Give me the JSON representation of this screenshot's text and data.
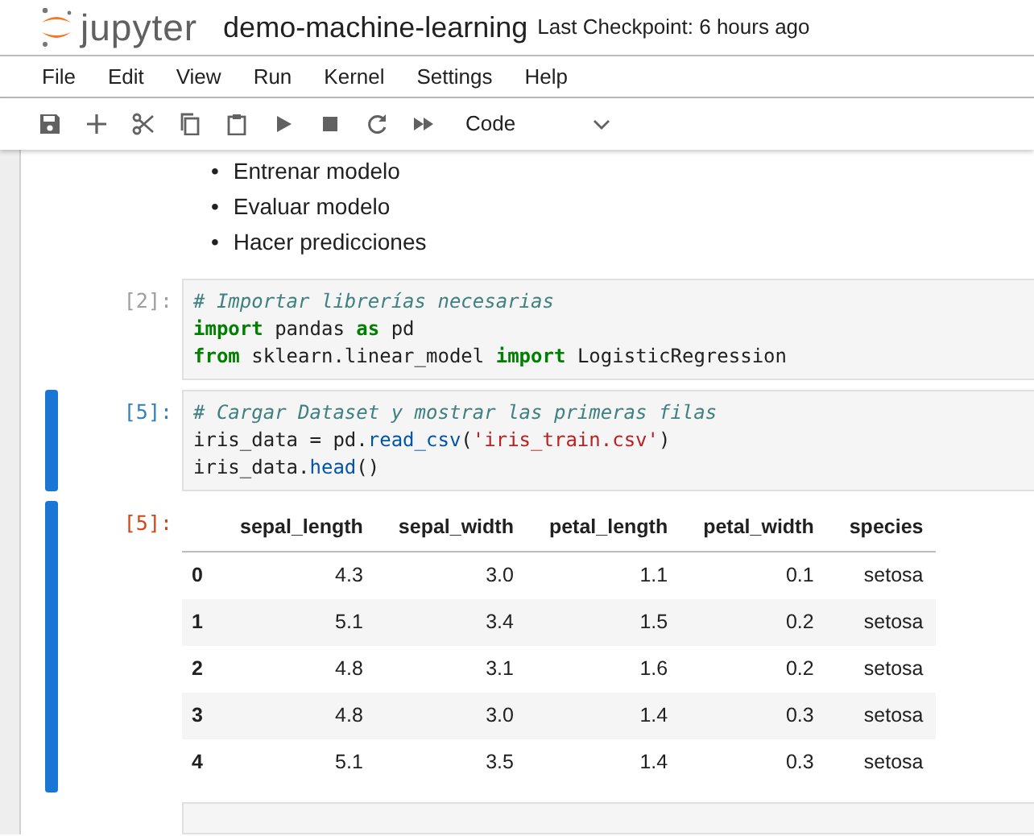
{
  "header": {
    "logo_text": "jupyter",
    "notebook_title": "demo-machine-learning",
    "checkpoint": "Last Checkpoint: 6 hours ago"
  },
  "menu": [
    "File",
    "Edit",
    "View",
    "Run",
    "Kernel",
    "Settings",
    "Help"
  ],
  "toolbar": {
    "buttons": [
      {
        "kind": "save"
      },
      {
        "kind": "add"
      },
      {
        "kind": "cut"
      },
      {
        "kind": "copy"
      },
      {
        "kind": "paste"
      },
      {
        "kind": "run"
      },
      {
        "kind": "stop"
      },
      {
        "kind": "restart"
      },
      {
        "kind": "run-all"
      }
    ],
    "cell_type": "Code"
  },
  "cells": [
    {
      "kind": "markdown",
      "active": false,
      "bullets": [
        {
          "marker": "•",
          "text": "Entrenar modelo"
        },
        {
          "marker": "•",
          "text": "Evaluar modelo"
        },
        {
          "marker": "•",
          "text": "Hacer predicciones"
        }
      ]
    },
    {
      "kind": "code",
      "active": false,
      "prompt": "[2]:",
      "lines": [
        [
          {
            "kind": "comment",
            "text": "# Importar librerías necesarias"
          }
        ],
        [
          {
            "kind": "keyword",
            "text": "import"
          },
          {
            "kind": "plain",
            "text": " pandas "
          },
          {
            "kind": "keyword",
            "text": "as"
          },
          {
            "kind": "plain",
            "text": " pd"
          }
        ],
        [
          {
            "kind": "keyword",
            "text": "from"
          },
          {
            "kind": "plain",
            "text": " sklearn.linear_model "
          },
          {
            "kind": "keyword",
            "text": "import"
          },
          {
            "kind": "plain",
            "text": " LogisticRegression"
          }
        ]
      ]
    },
    {
      "kind": "code",
      "active": true,
      "prompt": "[5]:",
      "lines": [
        [
          {
            "kind": "comment",
            "text": "# Cargar Dataset y mostrar las primeras filas"
          }
        ],
        [
          {
            "kind": "plain",
            "text": "iris_data = pd."
          },
          {
            "kind": "func",
            "text": "read_csv"
          },
          {
            "kind": "plain",
            "text": "("
          },
          {
            "kind": "string",
            "text": "'iris_train.csv'"
          },
          {
            "kind": "plain",
            "text": ")"
          }
        ],
        [
          {
            "kind": "plain",
            "text": "iris_data."
          },
          {
            "kind": "func",
            "text": "head"
          },
          {
            "kind": "plain",
            "text": "()"
          }
        ]
      ]
    },
    {
      "kind": "output",
      "active": true,
      "prompt": "[5]:",
      "table": {
        "columns": [
          "sepal_length",
          "sepal_width",
          "petal_length",
          "petal_width",
          "species"
        ],
        "rows": [
          {
            "index": "0",
            "cells": [
              "4.3",
              "3.0",
              "1.1",
              "0.1",
              "setosa"
            ]
          },
          {
            "index": "1",
            "cells": [
              "5.1",
              "3.4",
              "1.5",
              "0.2",
              "setosa"
            ]
          },
          {
            "index": "2",
            "cells": [
              "4.8",
              "3.1",
              "1.6",
              "0.2",
              "setosa"
            ]
          },
          {
            "index": "3",
            "cells": [
              "4.8",
              "3.0",
              "1.4",
              "0.3",
              "setosa"
            ]
          },
          {
            "index": "4",
            "cells": [
              "5.1",
              "3.5",
              "1.4",
              "0.3",
              "setosa"
            ]
          }
        ]
      }
    },
    {
      "kind": "empty",
      "active": false
    }
  ]
}
